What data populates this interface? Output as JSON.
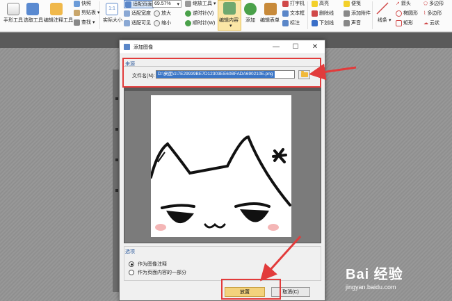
{
  "toolbar": {
    "hand_tool": "手形工具",
    "select_tool": "选取工具",
    "edit_annotation_tool": "编辑注释工具",
    "snapshot": "快照",
    "clipboard": "剪贴板",
    "find": "查找",
    "actual_size": "实际大小",
    "fit_page": "适配页面",
    "fit_width": "适配宽度",
    "fit_visible": "适配可见",
    "zoom_value": "69.57%",
    "zoom_in": "放大",
    "zoom_out": "缩小",
    "zoom_tool": "缩放工具",
    "rotate_left": "逆时针(V)",
    "rotate_right": "顺时针(W)",
    "edit_content": "编辑内容",
    "add": "添加",
    "edit_form": "编辑表单",
    "typewriter": "打字机",
    "text_box": "文本框",
    "callout": "标注",
    "highlight": "高亮",
    "strikeout": "删除线",
    "underline": "下划线",
    "note": "便笺",
    "attach_file": "添加附件",
    "sound": "声音",
    "line": "线条",
    "arrow": "箭头",
    "oval": "椭圆形",
    "rectangle": "矩形",
    "polygon": "多边形",
    "polyline": "多边形",
    "cloud": "云状"
  },
  "dialog": {
    "title": "添加图像",
    "source_group": "来源",
    "file_label": "文件名(N):",
    "file_value": "D:\\桌面\\1\\7E29939BE7D12303EE60BFADA690210E.png",
    "options_group": "选项",
    "option_annotation": "作为图像注释",
    "option_content": "作为页面内容的一部分",
    "place_button": "放置",
    "cancel_button": "取消(C)",
    "minimize": "—",
    "maximize": "☐",
    "close": "✕"
  },
  "watermark": {
    "brand": "Bai 经验",
    "url": "jingyan.baidu.com"
  },
  "colors": {
    "annotation_red": "#e23b3b",
    "selection_blue": "#3b76c7",
    "primary_button": "#f3d27c"
  }
}
